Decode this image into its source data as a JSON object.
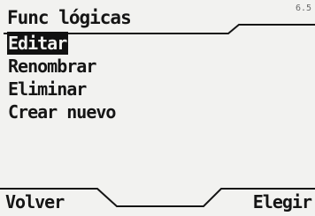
{
  "header": {
    "title": "Func lógicas",
    "version": "6.5"
  },
  "menu": {
    "items": [
      {
        "label": "Editar",
        "selected": true
      },
      {
        "label": "Renombrar",
        "selected": false
      },
      {
        "label": "Eliminar",
        "selected": false
      },
      {
        "label": "Crear nuevo",
        "selected": false
      }
    ]
  },
  "softkeys": {
    "left": "Volver",
    "right": "Elegir"
  }
}
